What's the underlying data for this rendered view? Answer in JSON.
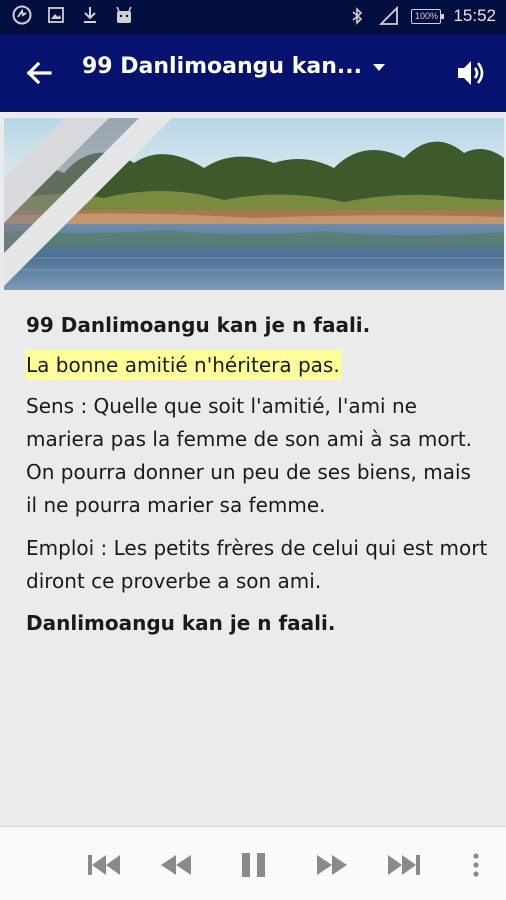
{
  "status_bar": {
    "time": "15:52",
    "battery": "100%",
    "icons": [
      "app-notification-icon",
      "image-icon",
      "download-icon",
      "android-icon",
      "bluetooth-icon",
      "signal-icon"
    ]
  },
  "app_bar": {
    "title": "99 Danlimoangu kan...",
    "icons": [
      "back-arrow-icon",
      "dropdown-arrow-icon",
      "volume-icon"
    ]
  },
  "article": {
    "heading": "99 Danlimoangu kan je n faali.",
    "highlight": "La bonne amitié n'héritera pas.",
    "sens": "Sens : Quelle que soit l'amitié, l'ami ne mariera pas la femme de son ami à sa mort. On pourra donner un peu de ses biens, mais il ne pourra marier sa femme.",
    "emploi": "Emploi : Les petits frères de celui qui est mort diront ce proverbe a son ami.",
    "closing": "Danlimoangu kan je n faali."
  },
  "player": {
    "controls": [
      "skip-previous-icon",
      "rewind-icon",
      "pause-icon",
      "fast-forward-icon",
      "skip-next-icon",
      "more-vert-icon"
    ]
  },
  "colors": {
    "status_bar": "#020e3e",
    "app_bar": "#05136e",
    "highlight": "#ffff99",
    "content_bg": "#ebebeb",
    "player_icons": "#8a8a8a"
  }
}
